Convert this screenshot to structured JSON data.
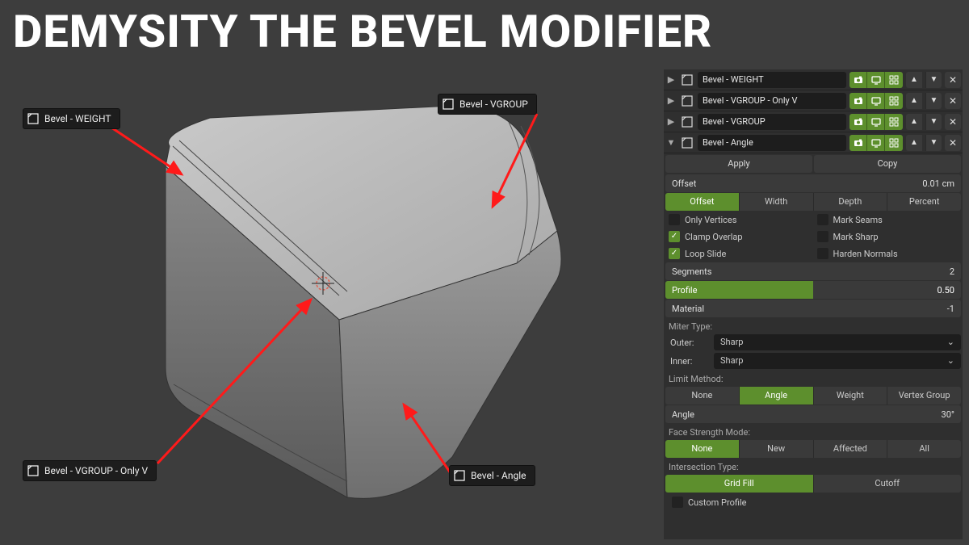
{
  "title": "DEMYSITY THE BEVEL MODIFIER",
  "viewport_labels": {
    "weight": "Bevel - WEIGHT",
    "vgroup": "Bevel - VGROUP",
    "vgroup_only_v": "Bevel - VGROUP - Only V",
    "angle": "Bevel - Angle"
  },
  "modifiers": [
    {
      "name": "Bevel - WEIGHT",
      "expanded": false
    },
    {
      "name": "Bevel - VGROUP - Only V",
      "expanded": false
    },
    {
      "name": "Bevel - VGROUP",
      "expanded": false
    },
    {
      "name": "Bevel - Angle",
      "expanded": true
    }
  ],
  "buttons": {
    "apply": "Apply",
    "copy": "Copy"
  },
  "offset": {
    "label": "Offset",
    "value": "0.01 cm"
  },
  "offset_type": {
    "options": [
      "Offset",
      "Width",
      "Depth",
      "Percent"
    ],
    "active": 0
  },
  "checks": {
    "only_vertices": {
      "label": "Only Vertices",
      "on": false
    },
    "mark_seams": {
      "label": "Mark Seams",
      "on": false
    },
    "clamp_overlap": {
      "label": "Clamp Overlap",
      "on": true
    },
    "mark_sharp": {
      "label": "Mark Sharp",
      "on": false
    },
    "loop_slide": {
      "label": "Loop Slide",
      "on": true
    },
    "harden_normals": {
      "label": "Harden Normals",
      "on": false
    }
  },
  "segments": {
    "label": "Segments",
    "value": "2"
  },
  "profile": {
    "label": "Profile",
    "value": "0.50",
    "fill_pct": 50
  },
  "material": {
    "label": "Material",
    "value": "-1"
  },
  "miter": {
    "label": "Miter Type:",
    "outer_label": "Outer:",
    "outer": "Sharp",
    "inner_label": "Inner:",
    "inner": "Sharp"
  },
  "limit": {
    "label": "Limit Method:",
    "options": [
      "None",
      "Angle",
      "Weight",
      "Vertex Group"
    ],
    "active": 1
  },
  "angle": {
    "label": "Angle",
    "value": "30°"
  },
  "face_strength": {
    "label": "Face Strength Mode:",
    "options": [
      "None",
      "New",
      "Affected",
      "All"
    ],
    "active": 0
  },
  "intersection": {
    "label": "Intersection Type:",
    "options": [
      "Grid Fill",
      "Cutoff"
    ],
    "active": 0
  },
  "custom_profile": {
    "label": "Custom Profile",
    "on": false
  }
}
